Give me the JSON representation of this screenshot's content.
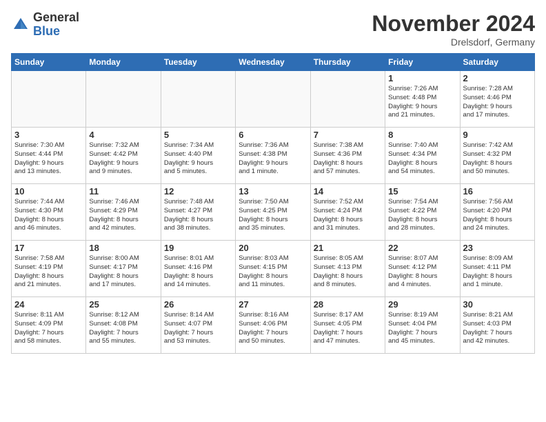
{
  "logo": {
    "general": "General",
    "blue": "Blue"
  },
  "title": "November 2024",
  "location": "Drelsdorf, Germany",
  "weekdays": [
    "Sunday",
    "Monday",
    "Tuesday",
    "Wednesday",
    "Thursday",
    "Friday",
    "Saturday"
  ],
  "weeks": [
    [
      {
        "day": "",
        "info": ""
      },
      {
        "day": "",
        "info": ""
      },
      {
        "day": "",
        "info": ""
      },
      {
        "day": "",
        "info": ""
      },
      {
        "day": "",
        "info": ""
      },
      {
        "day": "1",
        "info": "Sunrise: 7:26 AM\nSunset: 4:48 PM\nDaylight: 9 hours\nand 21 minutes."
      },
      {
        "day": "2",
        "info": "Sunrise: 7:28 AM\nSunset: 4:46 PM\nDaylight: 9 hours\nand 17 minutes."
      }
    ],
    [
      {
        "day": "3",
        "info": "Sunrise: 7:30 AM\nSunset: 4:44 PM\nDaylight: 9 hours\nand 13 minutes."
      },
      {
        "day": "4",
        "info": "Sunrise: 7:32 AM\nSunset: 4:42 PM\nDaylight: 9 hours\nand 9 minutes."
      },
      {
        "day": "5",
        "info": "Sunrise: 7:34 AM\nSunset: 4:40 PM\nDaylight: 9 hours\nand 5 minutes."
      },
      {
        "day": "6",
        "info": "Sunrise: 7:36 AM\nSunset: 4:38 PM\nDaylight: 9 hours\nand 1 minute."
      },
      {
        "day": "7",
        "info": "Sunrise: 7:38 AM\nSunset: 4:36 PM\nDaylight: 8 hours\nand 57 minutes."
      },
      {
        "day": "8",
        "info": "Sunrise: 7:40 AM\nSunset: 4:34 PM\nDaylight: 8 hours\nand 54 minutes."
      },
      {
        "day": "9",
        "info": "Sunrise: 7:42 AM\nSunset: 4:32 PM\nDaylight: 8 hours\nand 50 minutes."
      }
    ],
    [
      {
        "day": "10",
        "info": "Sunrise: 7:44 AM\nSunset: 4:30 PM\nDaylight: 8 hours\nand 46 minutes."
      },
      {
        "day": "11",
        "info": "Sunrise: 7:46 AM\nSunset: 4:29 PM\nDaylight: 8 hours\nand 42 minutes."
      },
      {
        "day": "12",
        "info": "Sunrise: 7:48 AM\nSunset: 4:27 PM\nDaylight: 8 hours\nand 38 minutes."
      },
      {
        "day": "13",
        "info": "Sunrise: 7:50 AM\nSunset: 4:25 PM\nDaylight: 8 hours\nand 35 minutes."
      },
      {
        "day": "14",
        "info": "Sunrise: 7:52 AM\nSunset: 4:24 PM\nDaylight: 8 hours\nand 31 minutes."
      },
      {
        "day": "15",
        "info": "Sunrise: 7:54 AM\nSunset: 4:22 PM\nDaylight: 8 hours\nand 28 minutes."
      },
      {
        "day": "16",
        "info": "Sunrise: 7:56 AM\nSunset: 4:20 PM\nDaylight: 8 hours\nand 24 minutes."
      }
    ],
    [
      {
        "day": "17",
        "info": "Sunrise: 7:58 AM\nSunset: 4:19 PM\nDaylight: 8 hours\nand 21 minutes."
      },
      {
        "day": "18",
        "info": "Sunrise: 8:00 AM\nSunset: 4:17 PM\nDaylight: 8 hours\nand 17 minutes."
      },
      {
        "day": "19",
        "info": "Sunrise: 8:01 AM\nSunset: 4:16 PM\nDaylight: 8 hours\nand 14 minutes."
      },
      {
        "day": "20",
        "info": "Sunrise: 8:03 AM\nSunset: 4:15 PM\nDaylight: 8 hours\nand 11 minutes."
      },
      {
        "day": "21",
        "info": "Sunrise: 8:05 AM\nSunset: 4:13 PM\nDaylight: 8 hours\nand 8 minutes."
      },
      {
        "day": "22",
        "info": "Sunrise: 8:07 AM\nSunset: 4:12 PM\nDaylight: 8 hours\nand 4 minutes."
      },
      {
        "day": "23",
        "info": "Sunrise: 8:09 AM\nSunset: 4:11 PM\nDaylight: 8 hours\nand 1 minute."
      }
    ],
    [
      {
        "day": "24",
        "info": "Sunrise: 8:11 AM\nSunset: 4:09 PM\nDaylight: 7 hours\nand 58 minutes."
      },
      {
        "day": "25",
        "info": "Sunrise: 8:12 AM\nSunset: 4:08 PM\nDaylight: 7 hours\nand 55 minutes."
      },
      {
        "day": "26",
        "info": "Sunrise: 8:14 AM\nSunset: 4:07 PM\nDaylight: 7 hours\nand 53 minutes."
      },
      {
        "day": "27",
        "info": "Sunrise: 8:16 AM\nSunset: 4:06 PM\nDaylight: 7 hours\nand 50 minutes."
      },
      {
        "day": "28",
        "info": "Sunrise: 8:17 AM\nSunset: 4:05 PM\nDaylight: 7 hours\nand 47 minutes."
      },
      {
        "day": "29",
        "info": "Sunrise: 8:19 AM\nSunset: 4:04 PM\nDaylight: 7 hours\nand 45 minutes."
      },
      {
        "day": "30",
        "info": "Sunrise: 8:21 AM\nSunset: 4:03 PM\nDaylight: 7 hours\nand 42 minutes."
      }
    ]
  ]
}
